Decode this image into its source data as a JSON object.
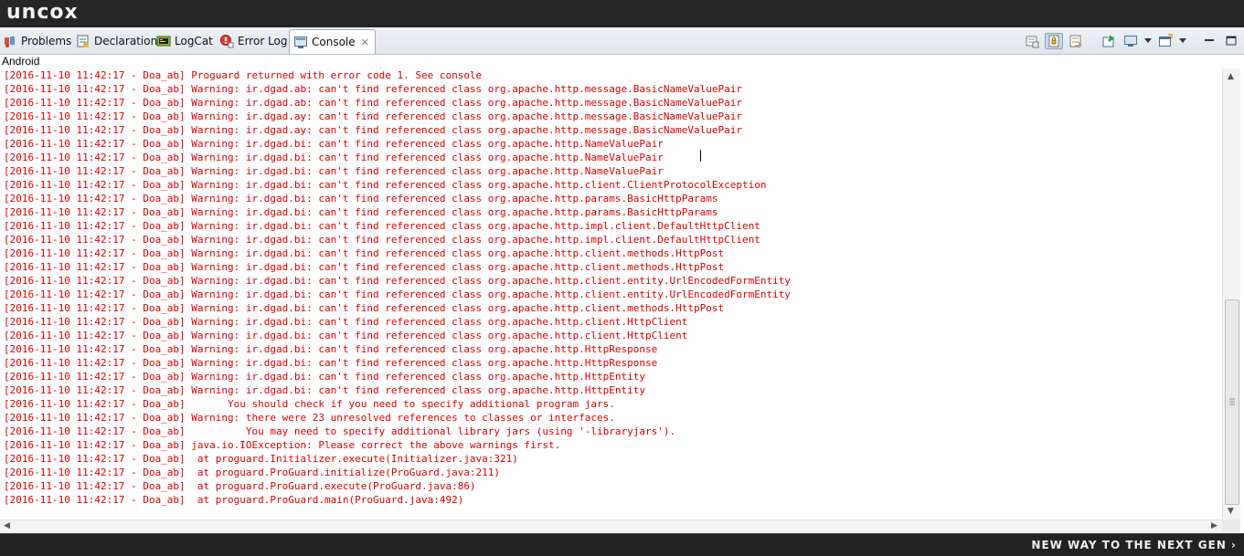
{
  "brand": {
    "logo": "uncox",
    "tagline": "NEW WAY TO THE NEXT GEN ›"
  },
  "tabs": [
    {
      "label": "Problems",
      "icon": "problems-icon"
    },
    {
      "label": "Declaration",
      "icon": "declaration-icon"
    },
    {
      "label": "LogCat",
      "icon": "logcat-icon"
    },
    {
      "label": "Error Log",
      "icon": "error-log-icon"
    },
    {
      "label": "Console",
      "icon": "console-icon",
      "active": true
    }
  ],
  "console": {
    "name": "Android",
    "text_color": "#e00000",
    "lines": [
      "[2016-11-10 11:42:17 - Doa_ab] Proguard returned with error code 1. See console",
      "[2016-11-10 11:42:17 - Doa_ab] Warning: ir.dgad.ab: can't find referenced class org.apache.http.message.BasicNameValuePair",
      "[2016-11-10 11:42:17 - Doa_ab] Warning: ir.dgad.ab: can't find referenced class org.apache.http.message.BasicNameValuePair",
      "[2016-11-10 11:42:17 - Doa_ab] Warning: ir.dgad.ay: can't find referenced class org.apache.http.message.BasicNameValuePair",
      "[2016-11-10 11:42:17 - Doa_ab] Warning: ir.dgad.ay: can't find referenced class org.apache.http.message.BasicNameValuePair",
      "[2016-11-10 11:42:17 - Doa_ab] Warning: ir.dgad.bi: can't find referenced class org.apache.http.NameValuePair",
      "[2016-11-10 11:42:17 - Doa_ab] Warning: ir.dgad.bi: can't find referenced class org.apache.http.NameValuePair",
      "[2016-11-10 11:42:17 - Doa_ab] Warning: ir.dgad.bi: can't find referenced class org.apache.http.NameValuePair",
      "[2016-11-10 11:42:17 - Doa_ab] Warning: ir.dgad.bi: can't find referenced class org.apache.http.client.ClientProtocolException",
      "[2016-11-10 11:42:17 - Doa_ab] Warning: ir.dgad.bi: can't find referenced class org.apache.http.params.BasicHttpParams",
      "[2016-11-10 11:42:17 - Doa_ab] Warning: ir.dgad.bi: can't find referenced class org.apache.http.params.BasicHttpParams",
      "[2016-11-10 11:42:17 - Doa_ab] Warning: ir.dgad.bi: can't find referenced class org.apache.http.impl.client.DefaultHttpClient",
      "[2016-11-10 11:42:17 - Doa_ab] Warning: ir.dgad.bi: can't find referenced class org.apache.http.impl.client.DefaultHttpClient",
      "[2016-11-10 11:42:17 - Doa_ab] Warning: ir.dgad.bi: can't find referenced class org.apache.http.client.methods.HttpPost",
      "[2016-11-10 11:42:17 - Doa_ab] Warning: ir.dgad.bi: can't find referenced class org.apache.http.client.methods.HttpPost",
      "[2016-11-10 11:42:17 - Doa_ab] Warning: ir.dgad.bi: can't find referenced class org.apache.http.client.entity.UrlEncodedFormEntity",
      "[2016-11-10 11:42:17 - Doa_ab] Warning: ir.dgad.bi: can't find referenced class org.apache.http.client.entity.UrlEncodedFormEntity",
      "[2016-11-10 11:42:17 - Doa_ab] Warning: ir.dgad.bi: can't find referenced class org.apache.http.client.methods.HttpPost",
      "[2016-11-10 11:42:17 - Doa_ab] Warning: ir.dgad.bi: can't find referenced class org.apache.http.client.HttpClient",
      "[2016-11-10 11:42:17 - Doa_ab] Warning: ir.dgad.bi: can't find referenced class org.apache.http.client.HttpClient",
      "[2016-11-10 11:42:17 - Doa_ab] Warning: ir.dgad.bi: can't find referenced class org.apache.http.HttpResponse",
      "[2016-11-10 11:42:17 - Doa_ab] Warning: ir.dgad.bi: can't find referenced class org.apache.http.HttpResponse",
      "[2016-11-10 11:42:17 - Doa_ab] Warning: ir.dgad.bi: can't find referenced class org.apache.http.HttpEntity",
      "[2016-11-10 11:42:17 - Doa_ab] Warning: ir.dgad.bi: can't find referenced class org.apache.http.HttpEntity",
      "[2016-11-10 11:42:17 - Doa_ab]       You should check if you need to specify additional program jars.",
      "[2016-11-10 11:42:17 - Doa_ab] Warning: there were 23 unresolved references to classes or interfaces.",
      "[2016-11-10 11:42:17 - Doa_ab]          You may need to specify additional library jars (using '-libraryjars').",
      "[2016-11-10 11:42:17 - Doa_ab] java.io.IOException: Please correct the above warnings first.",
      "[2016-11-10 11:42:17 - Doa_ab]  at proguard.Initializer.execute(Initializer.java:321)",
      "[2016-11-10 11:42:17 - Doa_ab]  at proguard.ProGuard.initialize(ProGuard.java:211)",
      "[2016-11-10 11:42:17 - Doa_ab]  at proguard.ProGuard.execute(ProGuard.java:86)",
      "[2016-11-10 11:42:17 - Doa_ab]  at proguard.ProGuard.main(ProGuard.java:492)"
    ]
  },
  "toolbar": [
    {
      "icon": "clear-console-icon"
    },
    {
      "icon": "scroll-lock-icon",
      "pressed": true
    },
    {
      "icon": "word-wrap-icon"
    },
    {
      "icon": "pin-console-icon"
    },
    {
      "icon": "display-console-icon"
    },
    {
      "icon": "open-console-icon"
    },
    {
      "icon": "view-menu-icon"
    },
    {
      "icon": "minimize-icon"
    },
    {
      "icon": "maximize-icon"
    }
  ]
}
